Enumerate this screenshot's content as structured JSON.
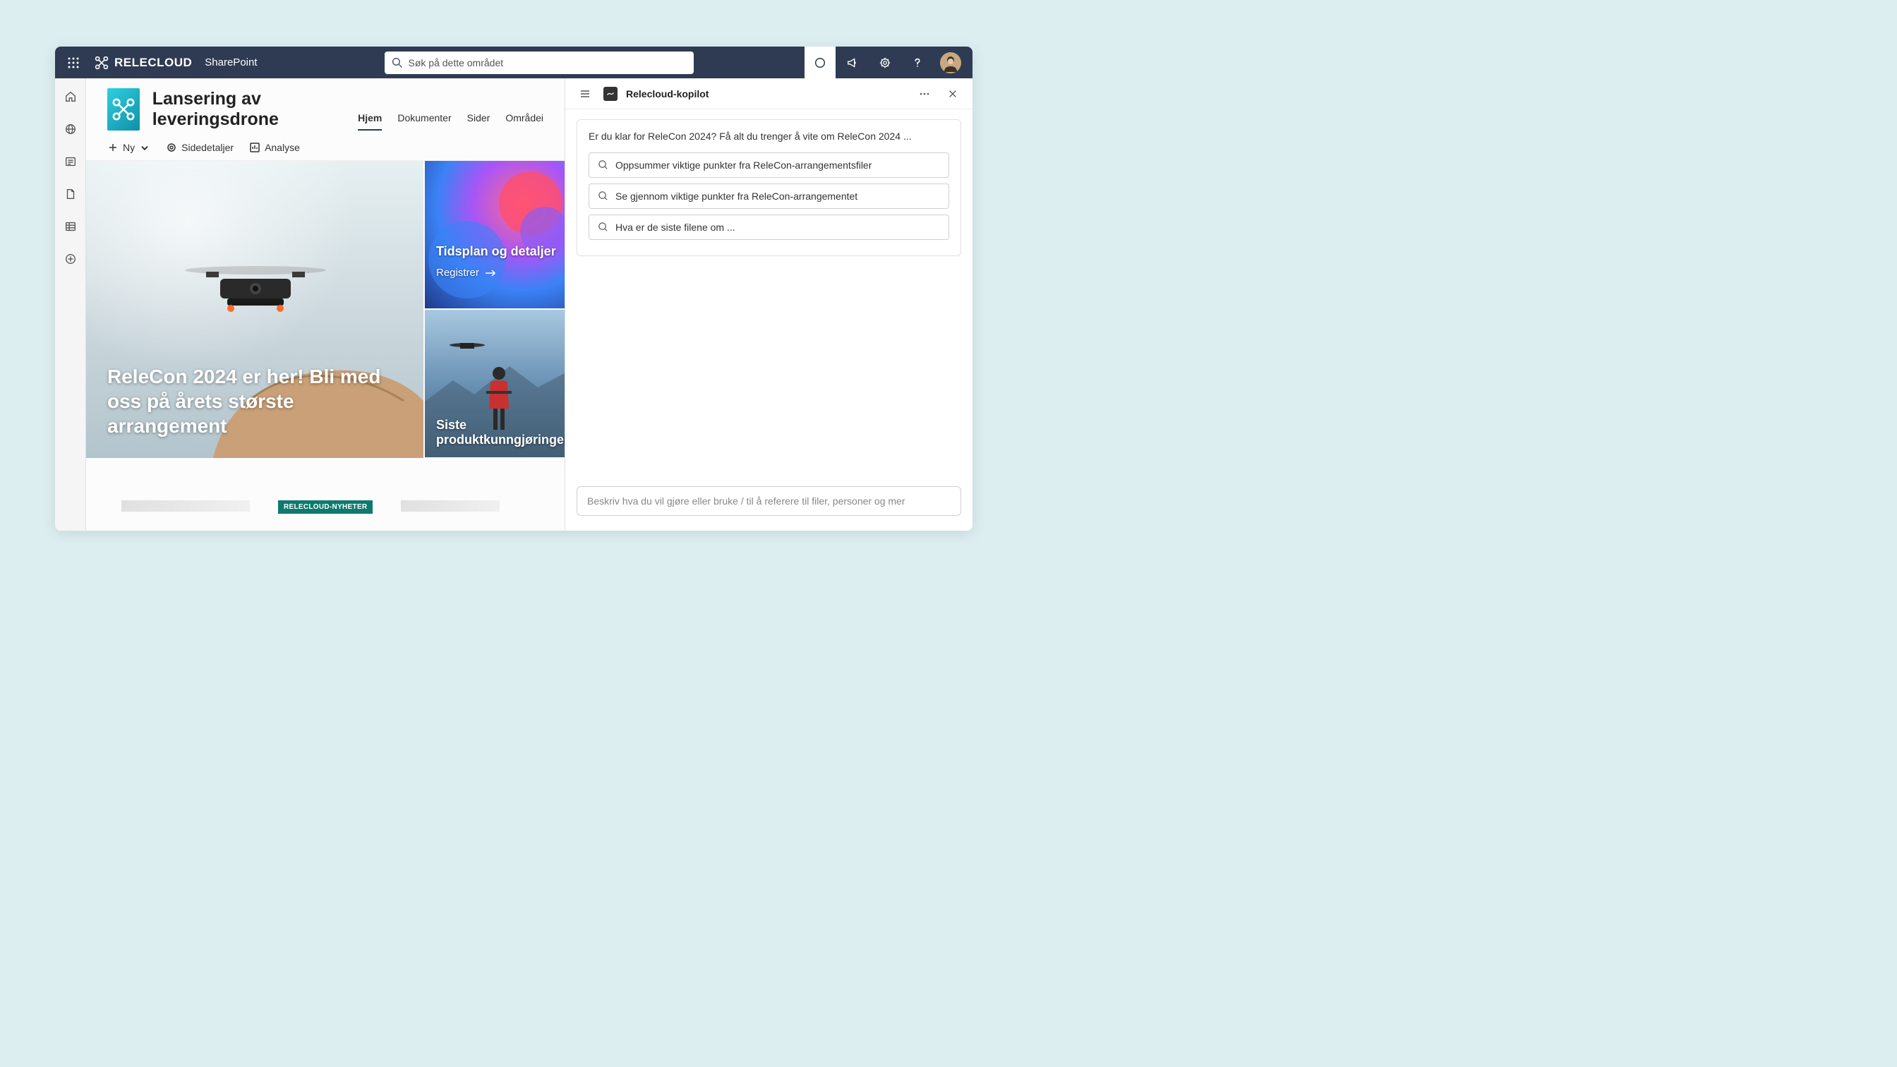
{
  "topbar": {
    "brand": "RELECLOUD",
    "suite": "SharePoint",
    "search_placeholder": "Søk på dette området"
  },
  "site": {
    "title": "Lansering av leveringsdrone",
    "nav": [
      "Hjem",
      "Dokumenter",
      "Sider",
      "Områdei"
    ]
  },
  "toolbar": {
    "new": "Ny",
    "page_details": "Sidedetaljer",
    "analytics": "Analyse"
  },
  "hero": {
    "main_title": "ReleCon 2024 er her! Bli med oss på årets største arrangement",
    "card1_title": "Tidsplan og detaljer",
    "card1_link": "Registrer",
    "card2_title": "Siste produktkunngjøringer"
  },
  "news": {
    "badge": "RELECLOUD-NYHETER"
  },
  "copilot": {
    "title": "Relecloud-kopilot",
    "intro": "Er du klar for ReleCon 2024? Få alt du trenger å vite om ReleCon 2024 ...",
    "suggestions": [
      "Oppsummer viktige punkter fra ReleCon-arrangementsfiler",
      "Se gjennom viktige punkter fra ReleCon-arrangementet",
      "Hva er de siste filene om ..."
    ],
    "input_placeholder": "Beskriv hva du vil gjøre eller bruke / til å referere til filer, personer og mer"
  }
}
